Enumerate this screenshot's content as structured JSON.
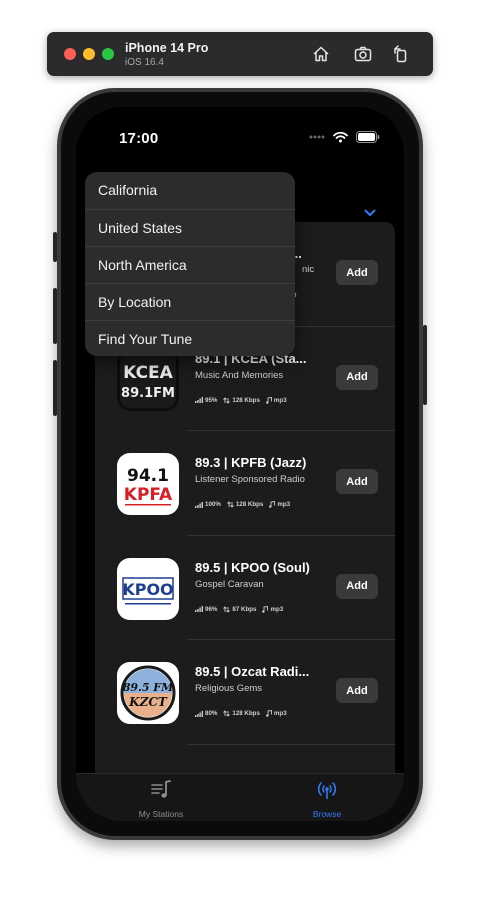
{
  "simulator": {
    "device": "iPhone 14 Pro",
    "os": "iOS 16.4"
  },
  "status_bar": {
    "time": "17:00"
  },
  "menu": {
    "items": [
      "California",
      "United States",
      "North America",
      "By Location",
      "Find Your Tune"
    ]
  },
  "hidden_row": {
    "title_fragment": "...",
    "desc_fragment": "nic",
    "meta_fragment": "3",
    "add_label": "Add"
  },
  "stations": [
    {
      "name": "89.1 | KCEA (Sta...",
      "description": "Music And Memories",
      "reliability": "95%",
      "bitrate": "128 Kbps",
      "codec": "mp3",
      "add_label": "Add",
      "logo": "kcea-logo",
      "logo_text": [
        "KCEA",
        "89.1FM"
      ]
    },
    {
      "name": "89.3 | KPFB (Jazz)",
      "description": "Listener Sponsored Radio",
      "reliability": "100%",
      "bitrate": "128 Kbps",
      "codec": "mp3",
      "add_label": "Add",
      "logo": "kpfa-logo",
      "logo_text": [
        "94.1",
        "KPFA"
      ]
    },
    {
      "name": "89.5 | KPOO (Soul)",
      "description": "Gospel Caravan",
      "reliability": "96%",
      "bitrate": "87 Kbps",
      "codec": "mp3",
      "add_label": "Add",
      "logo": "kpoo-logo",
      "logo_text": [
        "KPOO"
      ]
    },
    {
      "name": "89.5 | Ozcat Radi...",
      "description": "Religious Gems",
      "reliability": "80%",
      "bitrate": "128 Kbps",
      "codec": "mp3",
      "add_label": "Add",
      "logo": "kzct-logo",
      "logo_text": [
        "89.5 FM",
        "KZCT"
      ]
    }
  ],
  "tabs": [
    {
      "label": "My Stations",
      "icon": "music-note-list-icon",
      "selected": false
    },
    {
      "label": "Browse",
      "icon": "antenna-broadcast-icon",
      "selected": true
    }
  ],
  "colors": {
    "accent": "#2f7bf6",
    "background": "#000000",
    "panel": "#1c1c1e",
    "menu": "#2c2c2e"
  }
}
